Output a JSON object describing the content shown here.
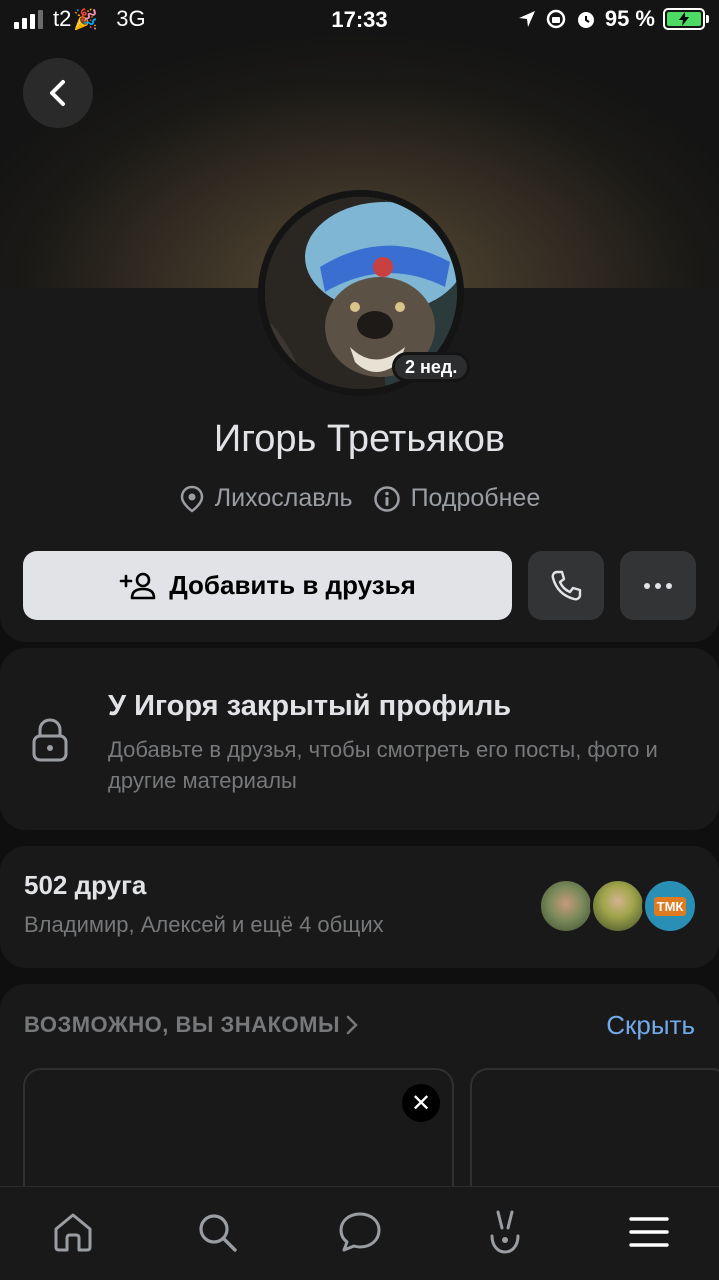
{
  "status_bar": {
    "carrier": "t2",
    "carrier_emoji": "🎉",
    "network": "3G",
    "time": "17:33",
    "battery": "95 %",
    "icons": [
      "signal-icon",
      "location-arrow-icon",
      "orientation-lock-icon",
      "alarm-icon",
      "battery-charging-icon"
    ]
  },
  "header": {
    "back_icon": "chevron-left-icon"
  },
  "profile": {
    "name": "Игорь Третьяков",
    "avatar_badge": "2 нед.",
    "location": "Лихославль",
    "details_label": "Подробнее",
    "add_friend_label": "Добавить в друзья",
    "icons": [
      "location-pin-icon",
      "info-icon",
      "add-friend-icon",
      "phone-icon",
      "more-icon"
    ]
  },
  "private_profile": {
    "title": "У Игоря закрытый профиль",
    "text": "Добавьте в друзья, чтобы смотреть его посты, фото и другие материалы"
  },
  "friends": {
    "count_label": "502 друга",
    "mutual_label": "Владимир, Алексей и ещё 4 общих",
    "logo_text": "ТМК"
  },
  "suggestions": {
    "title": "ВОЗМОЖНО, ВЫ ЗНАКОМЫ",
    "hide_label": "Скрыть",
    "close_symbol": "✕"
  },
  "tabbar": {
    "items": [
      "home-icon",
      "search-icon",
      "messages-icon",
      "clips-icon",
      "menu-icon"
    ]
  },
  "colors": {
    "background": "#0f0f0f",
    "card": "#19191a",
    "accent_link": "#71aaeb",
    "battery_green": "#4cd964"
  }
}
